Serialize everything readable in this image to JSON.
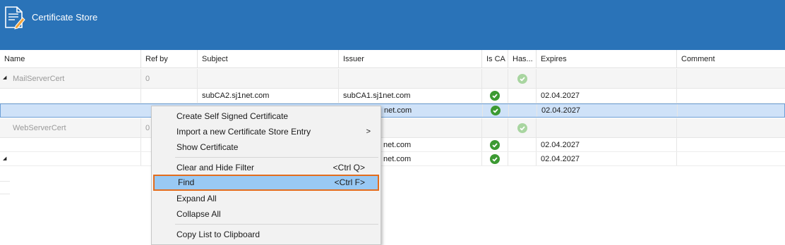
{
  "title": "Certificate Store",
  "columns": {
    "name": "Name",
    "ref_by": "Ref by",
    "subject": "Subject",
    "issuer": "Issuer",
    "is_ca": "Is CA",
    "has": "Has...",
    "expires": "Expires",
    "comment": "Comment"
  },
  "rows": [
    {
      "type": "group",
      "name": "MailServerCert",
      "ref_by": "0",
      "is_ca": "",
      "has": "check-faded"
    },
    {
      "type": "child",
      "subject": "subCA2.sj1net.com",
      "issuer": "subCA1.sj1net.com",
      "is_ca": "check",
      "expires": "02.04.2027"
    },
    {
      "type": "selected",
      "issuer": "net.com",
      "is_ca": "check",
      "expires": "02.04.2027"
    },
    {
      "type": "group",
      "name": "WebServerCert",
      "ref_by": "0",
      "has": "check-faded"
    },
    {
      "type": "child",
      "issuer": "net.com",
      "is_ca": "check",
      "expires": "02.04.2027"
    },
    {
      "type": "child",
      "issuer": "net.com",
      "is_ca": "check",
      "expires": "02.04.2027"
    }
  ],
  "context_menu": {
    "items": [
      {
        "label": "Create Self Signed Certificate"
      },
      {
        "label": "Import a new Certificate Store Entry",
        "submenu": ">"
      },
      {
        "label": "Show Certificate"
      },
      {
        "label": "Clear and Hide Filter",
        "shortcut": "<Ctrl Q>"
      },
      {
        "label": "Find",
        "shortcut": "<Ctrl F>"
      },
      {
        "label": "Expand All"
      },
      {
        "label": "Collapse All"
      },
      {
        "label": "Copy List to Clipboard"
      }
    ]
  },
  "colors": {
    "titlebar": "#2a73b8",
    "check": "#3c9a32",
    "highlight": "#99c9f4",
    "highlight_border": "#e36d1e"
  },
  "icons": {
    "title": "certificate-document-icon",
    "check": "check-circle-icon",
    "expander": "expand-triangle-icon"
  }
}
